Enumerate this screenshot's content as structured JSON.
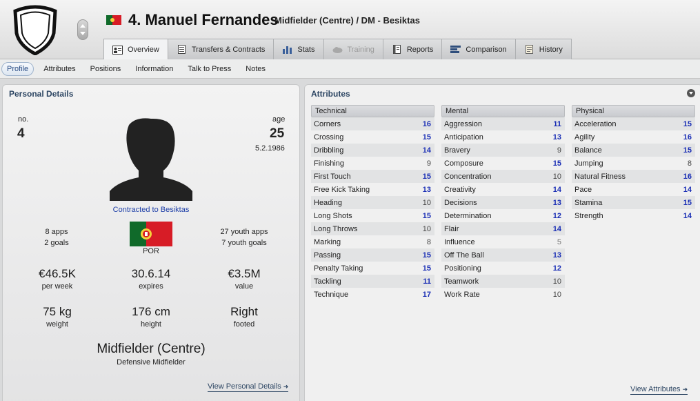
{
  "header": {
    "player_name": "4. Manuel Fernandes",
    "subtitle": "Midfielder (Centre) / DM - Besiktas",
    "nationality_flag": "portugal-flag-icon"
  },
  "tabs": [
    {
      "label": "Overview",
      "icon": "profile-card-icon",
      "active": true
    },
    {
      "label": "Transfers & Contracts",
      "icon": "document-icon"
    },
    {
      "label": "Stats",
      "icon": "bar-chart-icon"
    },
    {
      "label": "Training",
      "icon": "cloud-icon",
      "disabled": true
    },
    {
      "label": "Reports",
      "icon": "report-icon"
    },
    {
      "label": "Comparison",
      "icon": "comparison-icon"
    },
    {
      "label": "History",
      "icon": "history-icon"
    }
  ],
  "subnav": [
    "Profile",
    "Attributes",
    "Positions",
    "Information",
    "Talk to Press",
    "Notes"
  ],
  "personal": {
    "title": "Personal Details",
    "no_label": "no.",
    "no_value": "4",
    "age_label": "age",
    "age_value": "25",
    "dob": "5.2.1986",
    "contract": "Contracted to Besiktas",
    "apps": "8 apps",
    "goals": "2 goals",
    "youth_apps": "27 youth apps",
    "youth_goals": "7 youth goals",
    "nation": "POR",
    "wage": "€46.5K",
    "wage_label": "per week",
    "expires": "30.6.14",
    "expires_label": "expires",
    "value": "€3.5M",
    "value_label": "value",
    "weight": "75 kg",
    "weight_label": "weight",
    "height": "176 cm",
    "height_label": "height",
    "foot": "Right",
    "foot_label": "footed",
    "position": "Midfielder (Centre)",
    "role": "Defensive Midfielder",
    "view_link": "View Personal Details"
  },
  "attributes": {
    "title": "Attributes",
    "view_link": "View Attributes",
    "technical": {
      "label": "Technical",
      "rows": [
        {
          "name": "Corners",
          "value": "16"
        },
        {
          "name": "Crossing",
          "value": "15"
        },
        {
          "name": "Dribbling",
          "value": "14"
        },
        {
          "name": "Finishing",
          "value": "9"
        },
        {
          "name": "First Touch",
          "value": "15"
        },
        {
          "name": "Free Kick Taking",
          "value": "13"
        },
        {
          "name": "Heading",
          "value": "10"
        },
        {
          "name": "Long Shots",
          "value": "15"
        },
        {
          "name": "Long Throws",
          "value": "10"
        },
        {
          "name": "Marking",
          "value": "8"
        },
        {
          "name": "Passing",
          "value": "15"
        },
        {
          "name": "Penalty Taking",
          "value": "15"
        },
        {
          "name": "Tackling",
          "value": "11"
        },
        {
          "name": "Technique",
          "value": "17"
        }
      ]
    },
    "mental": {
      "label": "Mental",
      "rows": [
        {
          "name": "Aggression",
          "value": "11"
        },
        {
          "name": "Anticipation",
          "value": "13"
        },
        {
          "name": "Bravery",
          "value": "9"
        },
        {
          "name": "Composure",
          "value": "15"
        },
        {
          "name": "Concentration",
          "value": "10"
        },
        {
          "name": "Creativity",
          "value": "14"
        },
        {
          "name": "Decisions",
          "value": "13"
        },
        {
          "name": "Determination",
          "value": "12"
        },
        {
          "name": "Flair",
          "value": "14"
        },
        {
          "name": "Influence",
          "value": "5"
        },
        {
          "name": "Off The Ball",
          "value": "13"
        },
        {
          "name": "Positioning",
          "value": "12"
        },
        {
          "name": "Teamwork",
          "value": "10"
        },
        {
          "name": "Work Rate",
          "value": "10"
        }
      ]
    },
    "physical": {
      "label": "Physical",
      "rows": [
        {
          "name": "Acceleration",
          "value": "15"
        },
        {
          "name": "Agility",
          "value": "16"
        },
        {
          "name": "Balance",
          "value": "15"
        },
        {
          "name": "Jumping",
          "value": "8"
        },
        {
          "name": "Natural Fitness",
          "value": "16"
        },
        {
          "name": "Pace",
          "value": "14"
        },
        {
          "name": "Stamina",
          "value": "15"
        },
        {
          "name": "Strength",
          "value": "14"
        }
      ]
    }
  }
}
